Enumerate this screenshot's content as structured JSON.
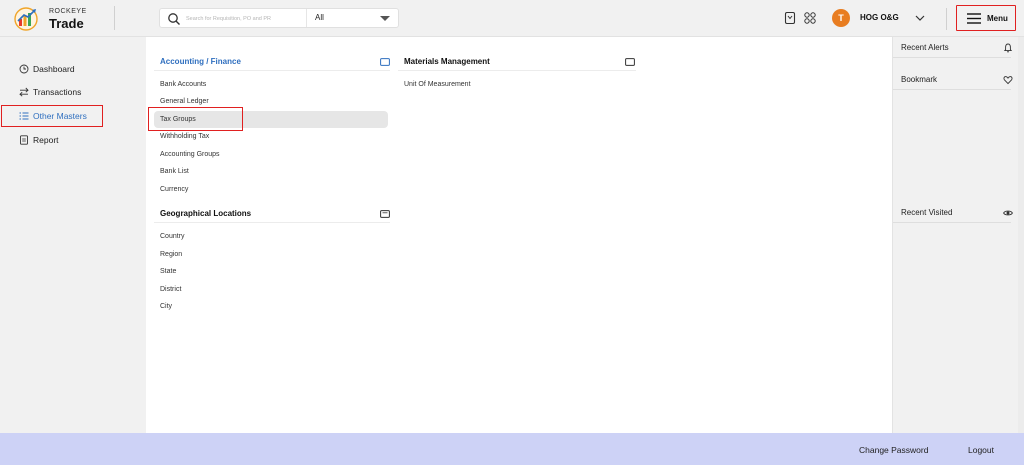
{
  "brand": {
    "small": "ROCKEYE",
    "name": "Trade"
  },
  "search": {
    "placeholder": "Search for Requisition, PO and PR",
    "scope": "All"
  },
  "user": {
    "initial": "T",
    "company": "HOG O&G"
  },
  "menu": {
    "label": "Menu"
  },
  "sidebar": {
    "items": [
      {
        "label": "Dashboard",
        "icon": "clock-icon"
      },
      {
        "label": "Transactions",
        "icon": "swap-arrows-icon"
      },
      {
        "label": "Other Masters",
        "icon": "list-icon",
        "active": true
      },
      {
        "label": "Report",
        "icon": "document-icon"
      }
    ]
  },
  "sections": {
    "accounting": {
      "title": "Accounting / Finance",
      "items": [
        "Bank Accounts",
        "General Ledger",
        "Tax Groups",
        "Withholding Tax",
        "Accounting Groups",
        "Bank List",
        "Currency"
      ],
      "selected": "Tax Groups"
    },
    "geo": {
      "title": "Geographical Locations",
      "items": [
        "Country",
        "Region",
        "State",
        "District",
        "City"
      ]
    },
    "materials": {
      "title": "Materials Management",
      "items": [
        "Unit Of Measurement"
      ]
    }
  },
  "right_panel": {
    "alerts": "Recent Alerts",
    "bookmark": "Bookmark",
    "visited": "Recent Visited"
  },
  "footer": {
    "change_password": "Change Password",
    "logout": "Logout"
  },
  "colors": {
    "accent": "#2f6fbf",
    "avatar": "#e87d21",
    "highlight": "#e02020",
    "footer": "#cdd2f6"
  }
}
